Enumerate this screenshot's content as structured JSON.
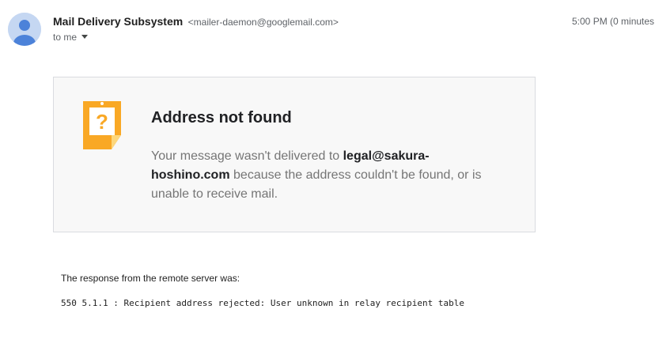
{
  "header": {
    "sender_name": "Mail Delivery Subsystem",
    "sender_email": "<mailer-daemon@googlemail.com>",
    "recipient": "to me",
    "timestamp": "5:00 PM (0 minutes"
  },
  "card": {
    "title": "Address not found",
    "body_prefix": "Your message wasn't delivered to",
    "address": "legal@sakura-hoshino.com",
    "body_suffix": "because the address couldn't be found, or is unable to receive mail.",
    "icon": "question-note-icon",
    "icon_color": "#f9a825"
  },
  "response": {
    "label": "The response from the remote server was:",
    "code": "550 5.1.1 : Recipient address rejected: User unknown in relay recipient table"
  },
  "colors": {
    "avatar_bg": "#c5d7f2",
    "avatar_fg": "#4c82d9",
    "card_bg": "#f8f8f8",
    "card_border": "#dadce0"
  }
}
